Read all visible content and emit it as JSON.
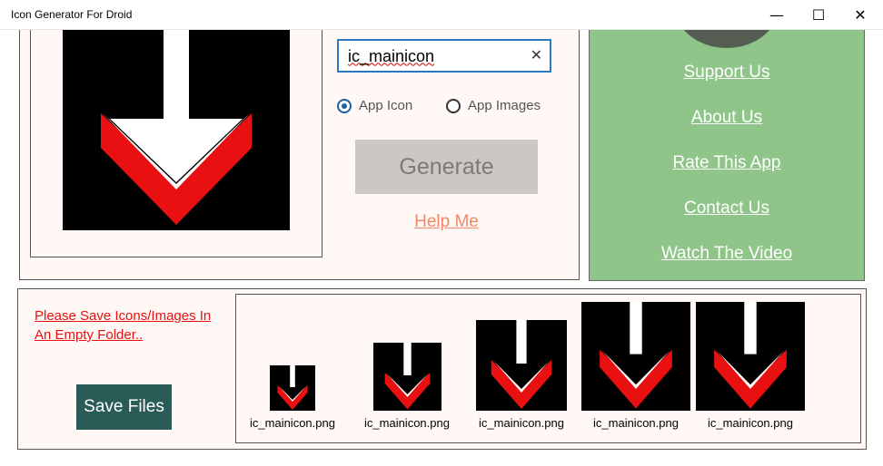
{
  "window": {
    "title": "Icon Generator For Droid",
    "minimize_glyph": "—",
    "maximize_glyph": "☐",
    "close_glyph": "✕"
  },
  "generator": {
    "name_input_value": "ic_mainicon",
    "clear_glyph": "✕",
    "radio_app_icon_label": "App Icon",
    "radio_app_images_label": "App Images",
    "selected_option": "App Icon",
    "generate_label": "Generate",
    "help_label": "Help Me"
  },
  "links": {
    "support": "Support Us",
    "about": "About Us",
    "rate": "Rate This App",
    "contact": "Contact Us",
    "video": "Watch The Video"
  },
  "output": {
    "warning": "Please Save Icons/Images In An Empty Folder..",
    "save_label": "Save Files",
    "files": [
      {
        "name": "ic_mainicon.png"
      },
      {
        "name": "ic_mainicon.png"
      },
      {
        "name": "ic_mainicon.png"
      },
      {
        "name": "ic_mainicon.png"
      },
      {
        "name": "ic_mainicon.png"
      }
    ]
  },
  "colors": {
    "accent_blue": "#2b79c2",
    "link_panel_green": "#8fc589",
    "save_button": "#2b5b57",
    "warning_red": "#e81010",
    "help_link": "#f1876a",
    "arrow_red": "#e81010",
    "arrow_white": "#ffffff",
    "icon_background": "#000000"
  },
  "icons": {
    "preview": "down-arrow-icon",
    "clear": "close-icon"
  }
}
